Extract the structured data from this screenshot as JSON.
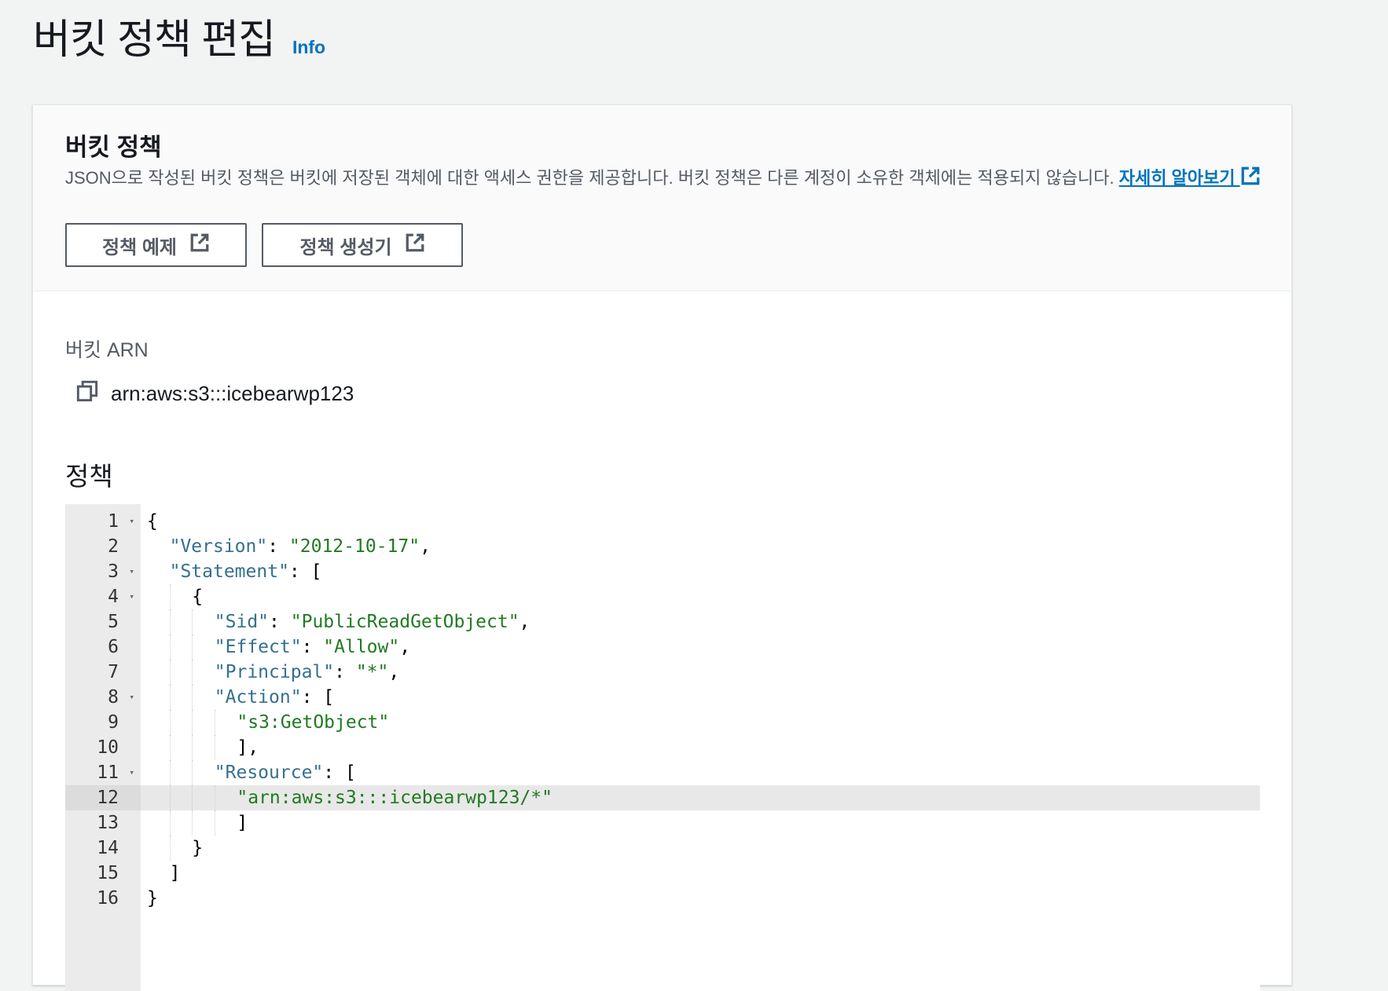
{
  "page": {
    "title": "버킷 정책 편집",
    "info_label": "Info"
  },
  "card": {
    "title": "버킷 정책",
    "description": "JSON으로 작성된 버킷 정책은 버킷에 저장된 객체에 대한 액세스 권한을 제공합니다. 버킷 정책은 다른 계정이 소유한 객체에는 적용되지 않습니다. ",
    "learn_more": "자세히 알아보기",
    "buttons": [
      {
        "label": "정책 예제",
        "icon": "external-link-icon"
      },
      {
        "label": "정책 생성기",
        "icon": "external-link-icon"
      }
    ]
  },
  "arn": {
    "label": "버킷 ARN",
    "value": "arn:aws:s3:::icebearwp123",
    "icon": "copy-icon"
  },
  "policy": {
    "label": "정책",
    "active_line": 12,
    "colors": {
      "key": "#35708e",
      "string": "#217a21"
    },
    "lines": [
      {
        "n": "1",
        "fold": true,
        "indent": 0,
        "parts": [
          [
            "p",
            "{"
          ]
        ]
      },
      {
        "n": "2",
        "fold": false,
        "indent": 1,
        "parts": [
          [
            "k",
            "\"Version\""
          ],
          [
            "p",
            ": "
          ],
          [
            "s",
            "\"2012-10-17\""
          ],
          [
            "p",
            ","
          ]
        ]
      },
      {
        "n": "3",
        "fold": true,
        "indent": 1,
        "parts": [
          [
            "k",
            "\"Statement\""
          ],
          [
            "p",
            ": ["
          ]
        ]
      },
      {
        "n": "4",
        "fold": true,
        "indent": 2,
        "parts": [
          [
            "p",
            "{"
          ]
        ]
      },
      {
        "n": "5",
        "fold": false,
        "indent": 3,
        "parts": [
          [
            "k",
            "\"Sid\""
          ],
          [
            "p",
            ": "
          ],
          [
            "s",
            "\"PublicReadGetObject\""
          ],
          [
            "p",
            ","
          ]
        ]
      },
      {
        "n": "6",
        "fold": false,
        "indent": 3,
        "parts": [
          [
            "k",
            "\"Effect\""
          ],
          [
            "p",
            ": "
          ],
          [
            "s",
            "\"Allow\""
          ],
          [
            "p",
            ","
          ]
        ]
      },
      {
        "n": "7",
        "fold": false,
        "indent": 3,
        "parts": [
          [
            "k",
            "\"Principal\""
          ],
          [
            "p",
            ": "
          ],
          [
            "s",
            "\"*\""
          ],
          [
            "p",
            ","
          ]
        ]
      },
      {
        "n": "8",
        "fold": true,
        "indent": 3,
        "parts": [
          [
            "k",
            "\"Action\""
          ],
          [
            "p",
            ": ["
          ]
        ]
      },
      {
        "n": "9",
        "fold": false,
        "indent": 4,
        "parts": [
          [
            "s",
            "\"s3:GetObject\""
          ]
        ]
      },
      {
        "n": "10",
        "fold": false,
        "indent": 4,
        "parts": [
          [
            "p",
            "],"
          ]
        ]
      },
      {
        "n": "11",
        "fold": true,
        "indent": 3,
        "parts": [
          [
            "k",
            "\"Resource\""
          ],
          [
            "p",
            ": ["
          ]
        ]
      },
      {
        "n": "12",
        "fold": false,
        "indent": 4,
        "parts": [
          [
            "s",
            "\"arn:aws:s3:::icebearwp123/*\""
          ]
        ]
      },
      {
        "n": "13",
        "fold": false,
        "indent": 4,
        "parts": [
          [
            "p",
            "]"
          ]
        ]
      },
      {
        "n": "14",
        "fold": false,
        "indent": 2,
        "parts": [
          [
            "p",
            "}"
          ]
        ]
      },
      {
        "n": "15",
        "fold": false,
        "indent": 1,
        "parts": [
          [
            "p",
            "]"
          ]
        ]
      },
      {
        "n": "16",
        "fold": false,
        "indent": 0,
        "parts": [
          [
            "p",
            "}"
          ]
        ]
      }
    ]
  }
}
